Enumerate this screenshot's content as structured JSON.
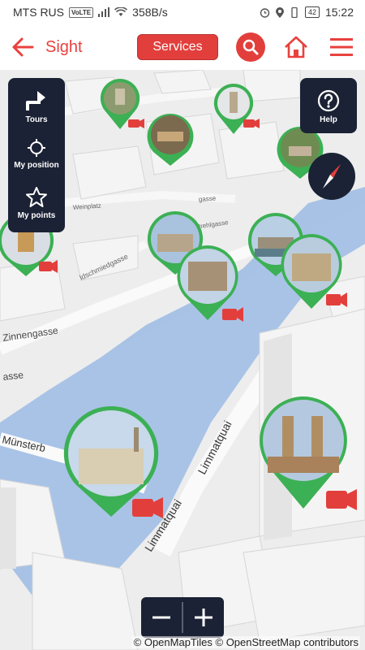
{
  "status_bar": {
    "carrier": "MTS RUS",
    "volte": "VoLTE",
    "speed": "358B/s",
    "battery": "42",
    "time": "15:22"
  },
  "app_bar": {
    "title": "Sight",
    "services_label": "Services",
    "icons": [
      "back-arrow-icon",
      "search-icon",
      "home-icon",
      "hamburger-menu-icon"
    ],
    "accent_color": "#e23f3c"
  },
  "side_panel": {
    "items": [
      {
        "label": "Tours",
        "icon": "route-turn-icon"
      },
      {
        "label": "My position",
        "icon": "crosshair-icon"
      },
      {
        "label": "My points",
        "icon": "star-icon"
      }
    ]
  },
  "help": {
    "label": "Help",
    "icon": "question-icon"
  },
  "compass": {
    "icon": "compass-icon"
  },
  "map": {
    "street_labels": [
      "Limmatquai",
      "Limmatquai",
      "Münsterb",
      "Zinnengasse",
      "asse",
      "ldschmiedgasse",
      "Weinplatz",
      "Strehlgasse",
      "gasse"
    ],
    "attribution": "© OpenMapTiles © OpenStreetMap contributors",
    "pin_color": "#3cb054",
    "video_badge_color": "#e23f3c"
  },
  "zoom": {
    "minus": "−",
    "plus": "+"
  }
}
